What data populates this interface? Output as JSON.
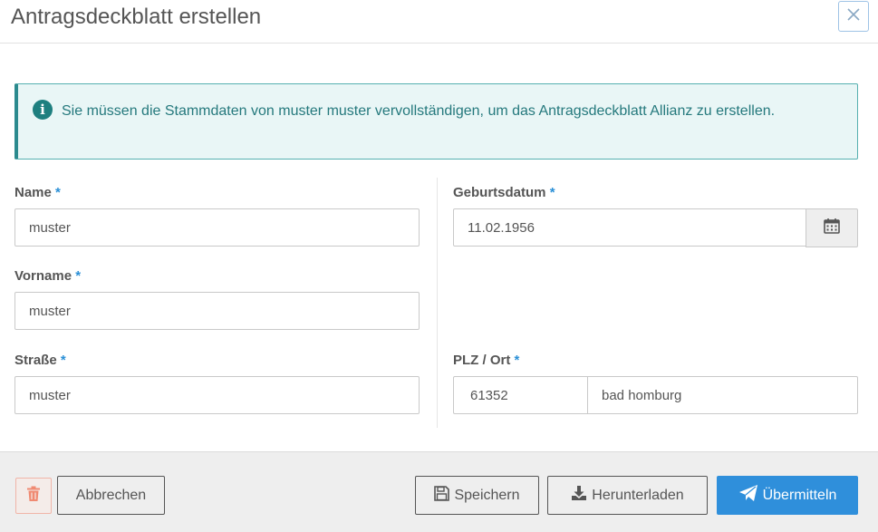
{
  "dialog": {
    "title": "Antragsdeckblatt erstellen"
  },
  "info": {
    "message": "Sie müssen die Stammdaten von muster muster vervollständigen, um das Antragsdeckblatt Allianz zu erstellen."
  },
  "form": {
    "required_marker": "*",
    "name": {
      "label": "Name",
      "value": "muster"
    },
    "vorname": {
      "label": "Vorname",
      "value": "muster"
    },
    "strasse": {
      "label": "Straße",
      "value": "muster"
    },
    "geburtsdatum": {
      "label": "Geburtsdatum",
      "value": "11.02.1956"
    },
    "plz_ort": {
      "label": "PLZ / Ort",
      "plz": "61352",
      "ort": "bad homburg"
    }
  },
  "footer": {
    "cancel_label": "Abbrechen",
    "save_label": "Speichern",
    "download_label": "Herunterladen",
    "submit_label": "Übermitteln"
  },
  "colors": {
    "accent": "#2f8fdb",
    "info_text": "#25797d",
    "info_bg": "#e9f6f6",
    "delete": "#f08a72"
  },
  "icons": [
    "close-icon",
    "info-icon",
    "calendar-icon",
    "trash-icon",
    "floppy-disk-icon",
    "download-icon",
    "paper-plane-icon"
  ]
}
